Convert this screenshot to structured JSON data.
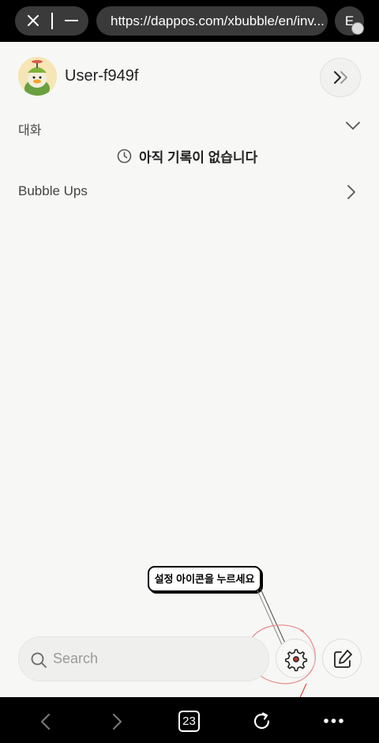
{
  "browser": {
    "url": "https://dappos.com/xbubble/en/inv...",
    "extension_label": "E",
    "tab_count": "23",
    "icons": {
      "close": "close-icon",
      "minimize": "minimize-icon",
      "back": "back-arrow-icon",
      "forward": "forward-arrow-icon",
      "reload": "reload-icon",
      "more": "more-dots-icon"
    }
  },
  "profile": {
    "username": "User-f949f",
    "avatar_icon": "duck-avatar-icon",
    "expand_icon": "double-chevron-right-icon"
  },
  "conversations": {
    "label": "대화",
    "empty_message": "아직 기록이 없습니다",
    "empty_icon": "clock-icon"
  },
  "bubble_ups": {
    "label": "Bubble Ups"
  },
  "tooltip": {
    "text": "설정 아이콘을 누르세요"
  },
  "search": {
    "placeholder": "Search"
  },
  "colors": {
    "background": "#f7f7f5",
    "browser_chrome": "#000000",
    "annotation": "#e88a8a"
  }
}
